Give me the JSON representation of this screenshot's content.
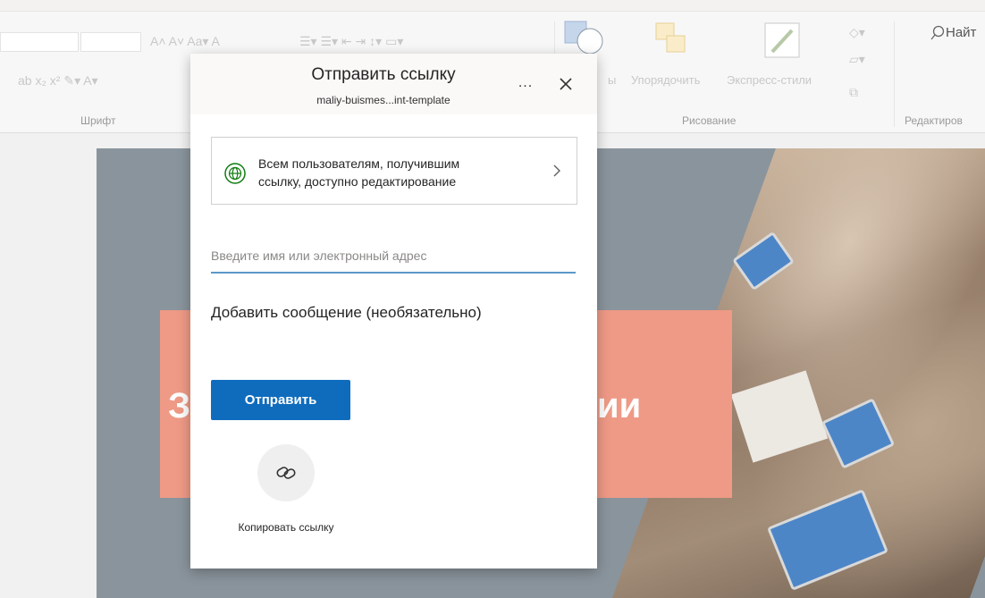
{
  "ribbon": {
    "groups": [
      {
        "label": "Шрифт"
      },
      {
        "label": "Рисование"
      },
      {
        "label": "Редактиров"
      }
    ],
    "arrange_label": "Упорядочить",
    "quick_styles_label": "Экспресс-стили",
    "find_label": "Найт",
    "shapes_fragment": "ы"
  },
  "slide": {
    "title_left_fragment": "З",
    "title_right_fragment": "ии"
  },
  "dialog": {
    "title": "Отправить ссылку",
    "subtitle": "maliy-buismes...int-template",
    "more_label": "...",
    "permission_line1": "Всем пользователям, получившим",
    "permission_line2": "ссылку, доступно редактирование",
    "email_placeholder": "Введите имя или электронный адрес",
    "email_value": "",
    "message_label": "Добавить сообщение (необязательно)",
    "send_label": "Отправить",
    "copy_link_label": "Копировать ссылку"
  },
  "colors": {
    "primary": "#0f6cbd",
    "input_underline": "#5c97c9",
    "slide_accent": "#ee9a86",
    "slide_bg": "#8a949c"
  }
}
